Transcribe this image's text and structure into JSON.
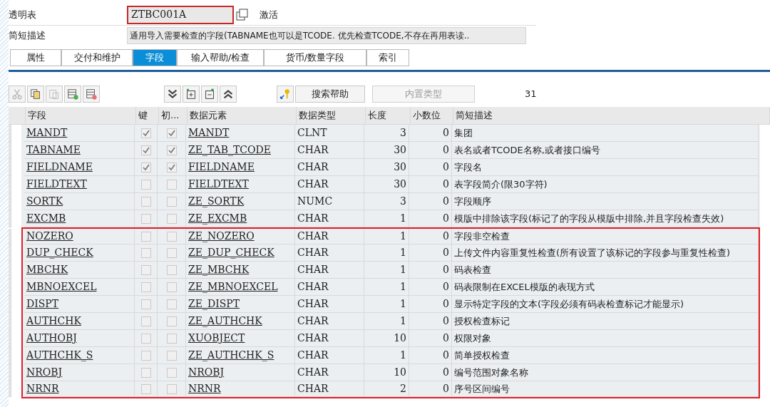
{
  "header": {
    "table_label": "透明表",
    "table_name": "ZTBC001A",
    "status": "激活",
    "desc_label": "简短描述",
    "description": "通用导入需要检查的字段(TABNAME也可以是TCODE. 优先检查TCODE,不存在再用表读.."
  },
  "tabs": [
    {
      "label": "属性",
      "selected": false
    },
    {
      "label": "交付和维护",
      "selected": false
    },
    {
      "label": "字段",
      "selected": true
    },
    {
      "label": "输入帮助/检查",
      "selected": false
    },
    {
      "label": "货币/数量字段",
      "selected": false
    },
    {
      "label": "索引",
      "selected": false
    }
  ],
  "toolbar": {
    "tools": [
      {
        "kind": "cut",
        "disabled": true
      },
      {
        "kind": "copy",
        "disabled": false
      },
      {
        "kind": "paste",
        "disabled": true
      },
      {
        "kind": "insert",
        "disabled": false
      },
      {
        "kind": "delete",
        "disabled": false
      }
    ],
    "nav": [
      {
        "kind": "down"
      },
      {
        "kind": "boxdown"
      },
      {
        "kind": "boxup"
      },
      {
        "kind": "up"
      }
    ],
    "search_help": "搜索帮助",
    "builtin_type": {
      "label": "内置类型",
      "disabled": true
    },
    "count": "31"
  },
  "table": {
    "columns": [
      "字段",
      "键",
      "初...",
      "数据元素",
      "数据类型",
      "长度",
      "小数位",
      "简短描述"
    ],
    "rows": [
      {
        "field": "MANDT",
        "key": true,
        "initial": true,
        "element": "MANDT",
        "type": "CLNT",
        "length": "3",
        "decimals": "0",
        "text": "集团",
        "highlighted": false
      },
      {
        "field": "TABNAME",
        "key": true,
        "initial": true,
        "element": "ZE_TAB_TCODE",
        "type": "CHAR",
        "length": "30",
        "decimals": "0",
        "text": "表名或者TCODE名称,或者接口编号",
        "highlighted": false
      },
      {
        "field": "FIELDNAME",
        "key": true,
        "initial": true,
        "element": "FIELDNAME",
        "type": "CHAR",
        "length": "30",
        "decimals": "0",
        "text": "字段名",
        "highlighted": false
      },
      {
        "field": "FIELDTEXT",
        "key": false,
        "initial": false,
        "element": "FIELDTEXT",
        "type": "CHAR",
        "length": "30",
        "decimals": "0",
        "text": "表字段简介(限30字符)",
        "highlighted": false
      },
      {
        "field": "SORTK",
        "key": false,
        "initial": false,
        "element": "ZE_SORTK",
        "type": "NUMC",
        "length": "3",
        "decimals": "0",
        "text": "字段顺序",
        "highlighted": false
      },
      {
        "field": "EXCMB",
        "key": false,
        "initial": false,
        "element": "ZE_EXCMB",
        "type": "CHAR",
        "length": "1",
        "decimals": "0",
        "text": "模版中排除该字段(标记了的字段从模版中排除,并且字段检查失效)",
        "highlighted": false
      },
      {
        "field": "NOZERO",
        "key": false,
        "initial": false,
        "element": "ZE_NOZERO",
        "type": "CHAR",
        "length": "1",
        "decimals": "0",
        "text": "字段非空检查",
        "highlighted": true
      },
      {
        "field": "DUP_CHECK",
        "key": false,
        "initial": false,
        "element": "ZE_DUP_CHECK",
        "type": "CHAR",
        "length": "1",
        "decimals": "0",
        "text": "上传文件内容重复性检查(所有设置了该标记的字段参与重复性检查)",
        "highlighted": true
      },
      {
        "field": "MBCHK",
        "key": false,
        "initial": false,
        "element": "ZE_MBCHK",
        "type": "CHAR",
        "length": "1",
        "decimals": "0",
        "text": "码表检查",
        "highlighted": true
      },
      {
        "field": "MBNOEXCEL",
        "key": false,
        "initial": false,
        "element": "ZE_MBNOEXCEL",
        "type": "CHAR",
        "length": "1",
        "decimals": "0",
        "text": "码表限制在EXCEL模版的表现方式",
        "highlighted": true
      },
      {
        "field": "DISPT",
        "key": false,
        "initial": false,
        "element": "ZE_DISPT",
        "type": "CHAR",
        "length": "1",
        "decimals": "0",
        "text": "显示特定字段的文本(字段必须有码表检查标记才能显示)",
        "highlighted": true
      },
      {
        "field": "AUTHCHK",
        "key": false,
        "initial": false,
        "element": "ZE_AUTHCHK",
        "type": "CHAR",
        "length": "1",
        "decimals": "0",
        "text": "授权检查标记",
        "highlighted": true
      },
      {
        "field": "AUTHOBJ",
        "key": false,
        "initial": false,
        "element": "XUOBJECT",
        "type": "CHAR",
        "length": "10",
        "decimals": "0",
        "text": "权限对象",
        "highlighted": true
      },
      {
        "field": "AUTHCHK_S",
        "key": false,
        "initial": false,
        "element": "ZE_AUTHCHK_S",
        "type": "CHAR",
        "length": "1",
        "decimals": "0",
        "text": "简单授权检查",
        "highlighted": true
      },
      {
        "field": "NROBJ",
        "key": false,
        "initial": false,
        "element": "NROBJ",
        "type": "CHAR",
        "length": "10",
        "decimals": "0",
        "text": "编号范围对象名称",
        "highlighted": true
      },
      {
        "field": "NRNR",
        "key": false,
        "initial": false,
        "element": "NRNR",
        "type": "CHAR",
        "length": "2",
        "decimals": "0",
        "text": "序号区间编号",
        "highlighted": true
      }
    ]
  }
}
